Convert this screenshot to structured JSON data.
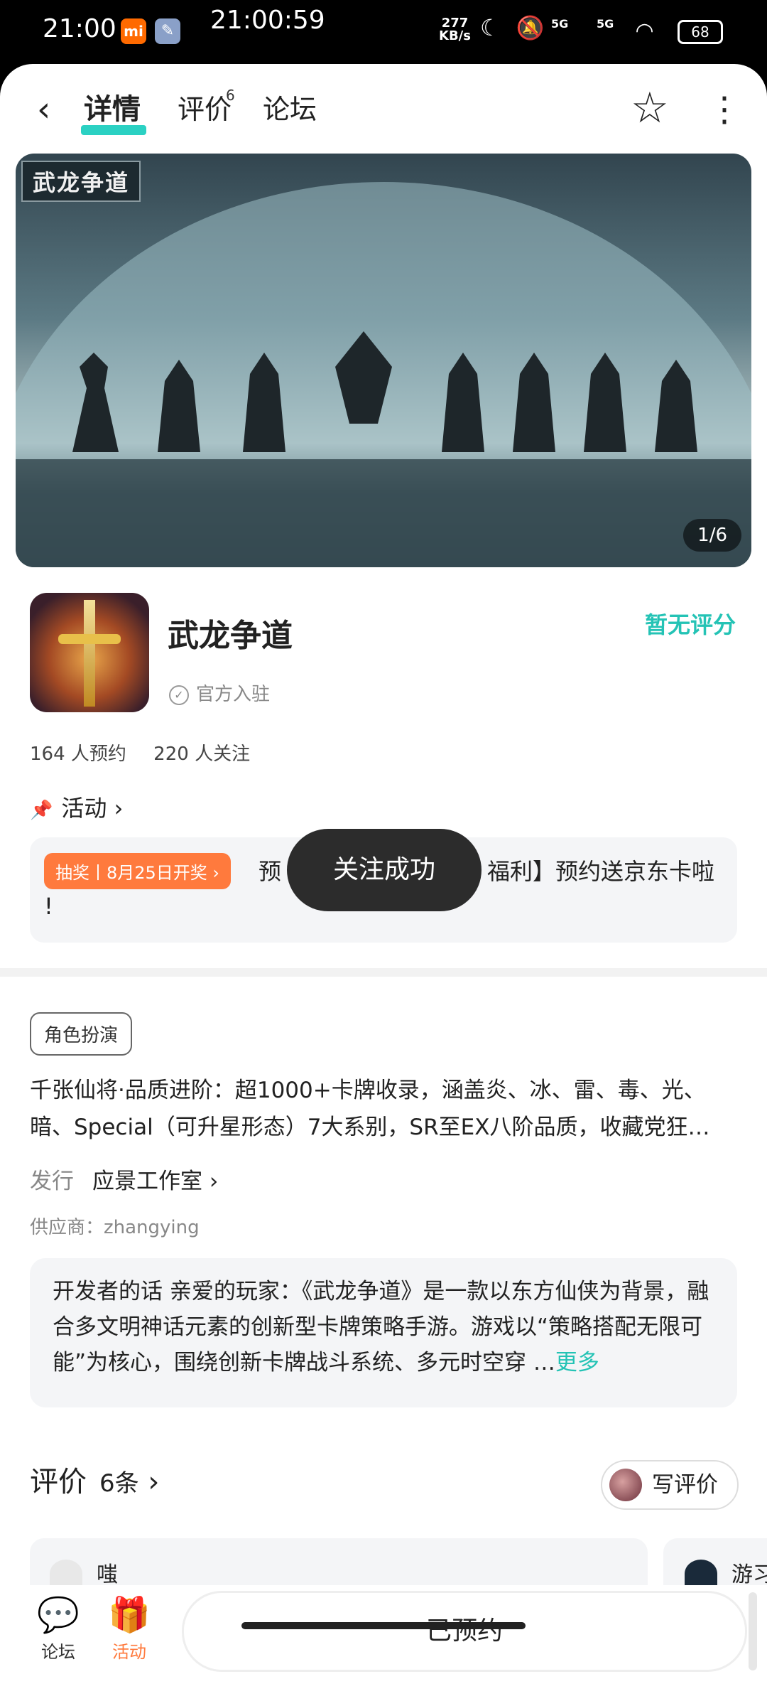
{
  "status_bar": {
    "time": "21:00",
    "center_time": "21:00:59",
    "net_speed_top": "277",
    "net_speed_unit": "KB/s",
    "signal1": "5G",
    "signal2": "5G",
    "battery": "68"
  },
  "header": {
    "tabs": [
      {
        "label": "详情",
        "active": true
      },
      {
        "label": "评价",
        "badge": "6"
      },
      {
        "label": "论坛"
      }
    ]
  },
  "banner": {
    "logo_text": "武龙争道",
    "counter": "1/6"
  },
  "app": {
    "name": "武龙争道",
    "official": "官方入驻",
    "rating": "暂无评分",
    "reservations": "164 人预约",
    "followers": "220 人关注"
  },
  "activity": {
    "section_label": "活动",
    "tag": "抽奖丨8月25日开奖 ›",
    "text_left": "预",
    "text_right": "福利】预约送京东卡啦",
    "text_line2": "!"
  },
  "toast": "关注成功",
  "details": {
    "genre": "角色扮演",
    "description": "千张仙将·品质进阶：超1000+卡牌收录，涵盖炎、冰、雷、毒、光、暗、Special（可升星形态）7大系别，SR至EX八阶品质，收藏党狂…",
    "publisher_label": "发行",
    "publisher": "应景工作室",
    "supplier": "供应商：zhangying",
    "dev_note": "开发者的话  亲爱的玩家：《武龙争道》是一款以东方仙侠为背景，融合多文明神话元素的创新型卡牌策略手游。游戏以“策略搭配无限可能”为核心，围绕创新卡牌战斗系统、多元时空穿 …",
    "more": "更多"
  },
  "reviews": {
    "title": "评价",
    "count": "6条",
    "write": "写评价",
    "first_name": "嗤",
    "second_name": "游习"
  },
  "bottom_bar": {
    "forum": "论坛",
    "activity": "活动",
    "reserved": "已预约"
  }
}
